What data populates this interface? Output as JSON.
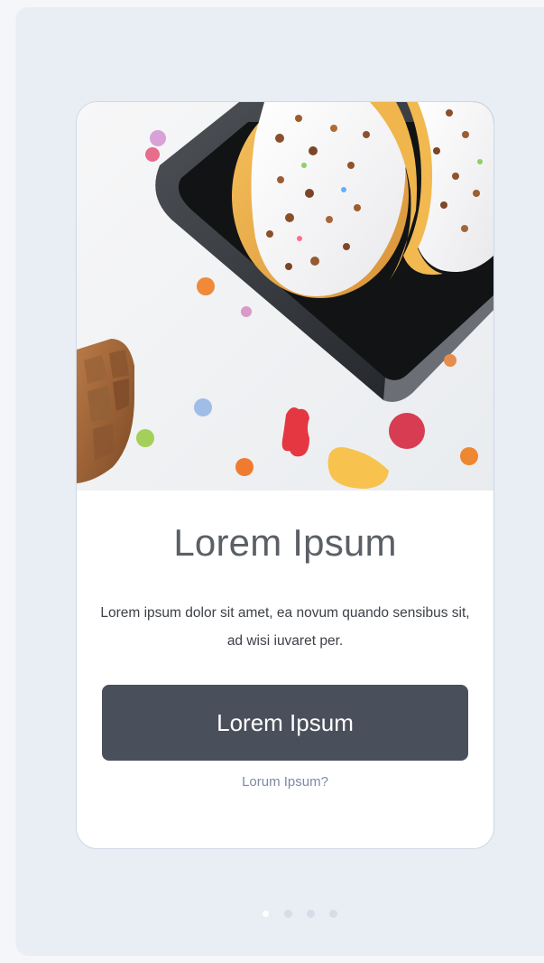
{
  "card": {
    "title": "Lorem Ipsum",
    "description": "Lorem ipsum dolor sit amet, ea novum quando sensibus sit, ad wisi iuvaret per.",
    "primary_button_label": "Lorem Ipsum",
    "secondary_link_label": "Lorum Ipsum?"
  },
  "pager": {
    "total": 4,
    "active_index": 0
  },
  "colors": {
    "page_background": "#e9edf4",
    "card_background": "#ffffff",
    "button_background": "#4a505b",
    "button_text": "#ffffff",
    "link_text": "#7d8aa3"
  },
  "hero_image": {
    "alt_name": "donut-candy-hero-image"
  }
}
